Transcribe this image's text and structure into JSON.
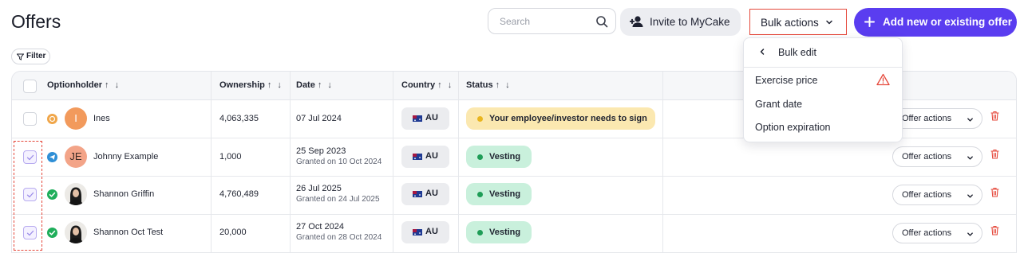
{
  "header": {
    "title": "Offers",
    "search_placeholder": "Search",
    "invite_label": "Invite to MyCake",
    "bulk_actions_label": "Bulk actions",
    "add_offer_label": "Add new or existing offer",
    "filter_label": "Filter"
  },
  "table": {
    "columns": [
      "Optionholder",
      "Ownership",
      "Date",
      "Country",
      "Status"
    ],
    "sort_arrows": "↑ ↓",
    "rows": [
      {
        "initial": "I",
        "name": "Ines",
        "ownership": "4,063,335",
        "date": "07 Jul 2024",
        "granted": "",
        "country": "AU",
        "status": "Your employee/investor needs to sign",
        "checked": false,
        "actions": "Offer actions"
      },
      {
        "initial": "JE",
        "name": "Johnny Example",
        "ownership": "1,000",
        "date": "25 Sep 2023",
        "granted": "Granted on 10 Oct 2024",
        "country": "AU",
        "status": "Vesting",
        "checked": true,
        "actions": "Offer actions"
      },
      {
        "initial": "",
        "name": "Shannon Griffin",
        "ownership": "4,760,489",
        "date": "26 Jul 2025",
        "granted": "Granted on 24 Jul 2025",
        "country": "AU",
        "status": "Vesting",
        "checked": true,
        "actions": "Offer actions"
      },
      {
        "initial": "",
        "name": "Shannon Oct Test",
        "ownership": "20,000",
        "date": "27 Oct 2024",
        "granted": "Granted on 28 Oct 2024",
        "country": "AU",
        "status": "Vesting",
        "checked": true,
        "actions": "Offer actions"
      }
    ]
  },
  "dropdown": {
    "back_label": "Bulk edit",
    "items": [
      "Exercise price",
      "Grant date",
      "Option expiration"
    ]
  },
  "colors": {
    "accent": "#5a3df0",
    "warning_badge": "#fbe8b0",
    "vesting_badge": "#c9f0dc",
    "highlight": "#e5483b"
  }
}
